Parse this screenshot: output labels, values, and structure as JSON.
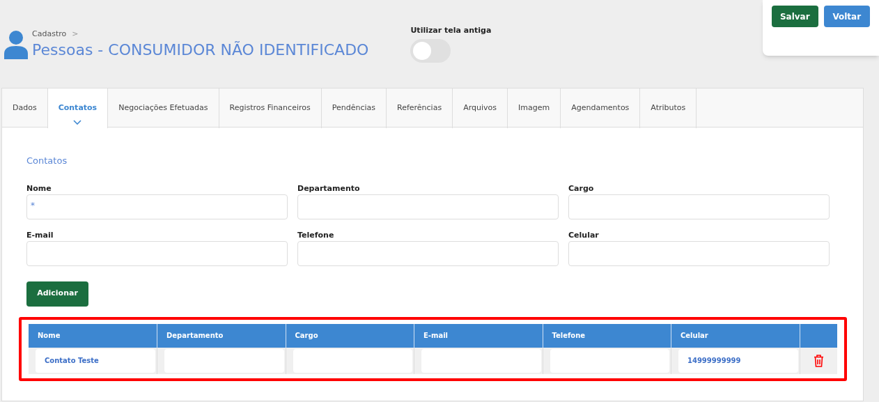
{
  "header": {
    "breadcrumb": "Cadastro",
    "breadcrumb_separator": ">",
    "title": "Pessoas - CONSUMIDOR NÃO IDENTIFICADO"
  },
  "old_screen_toggle": {
    "label": "Utilizar tela antiga",
    "on": false
  },
  "actions": [
    "Salvar",
    "Voltar"
  ],
  "tabs": [
    {
      "label": "Dados",
      "selected": false
    },
    {
      "label": "Contatos",
      "selected": true
    },
    {
      "label": "Negociações Efetuadas",
      "selected": false
    },
    {
      "label": "Registros Financeiros",
      "selected": false
    },
    {
      "label": "Pendências",
      "selected": false
    },
    {
      "label": "Referências",
      "selected": false
    },
    {
      "label": "Arquivos",
      "selected": false
    },
    {
      "label": "Imagem",
      "selected": false
    },
    {
      "label": "Agendamentos",
      "selected": false
    },
    {
      "label": "Atributos",
      "selected": false
    }
  ],
  "section_title": "Contatos",
  "fields": [
    {
      "label": "Nome",
      "required_mark": "*"
    },
    {
      "label": "Departamento"
    },
    {
      "label": "Cargo"
    },
    {
      "label": "E-mail"
    },
    {
      "label": "Telefone"
    },
    {
      "label": "Celular"
    }
  ],
  "add_button": "Adicionar",
  "table": {
    "columns": [
      "Nome",
      "Departamento",
      "Cargo",
      "E-mail",
      "Telefone",
      "Celular"
    ],
    "rows": [
      {
        "cells": [
          "Contato Teste",
          "",
          "",
          "",
          "",
          "14999999999"
        ]
      }
    ]
  }
}
